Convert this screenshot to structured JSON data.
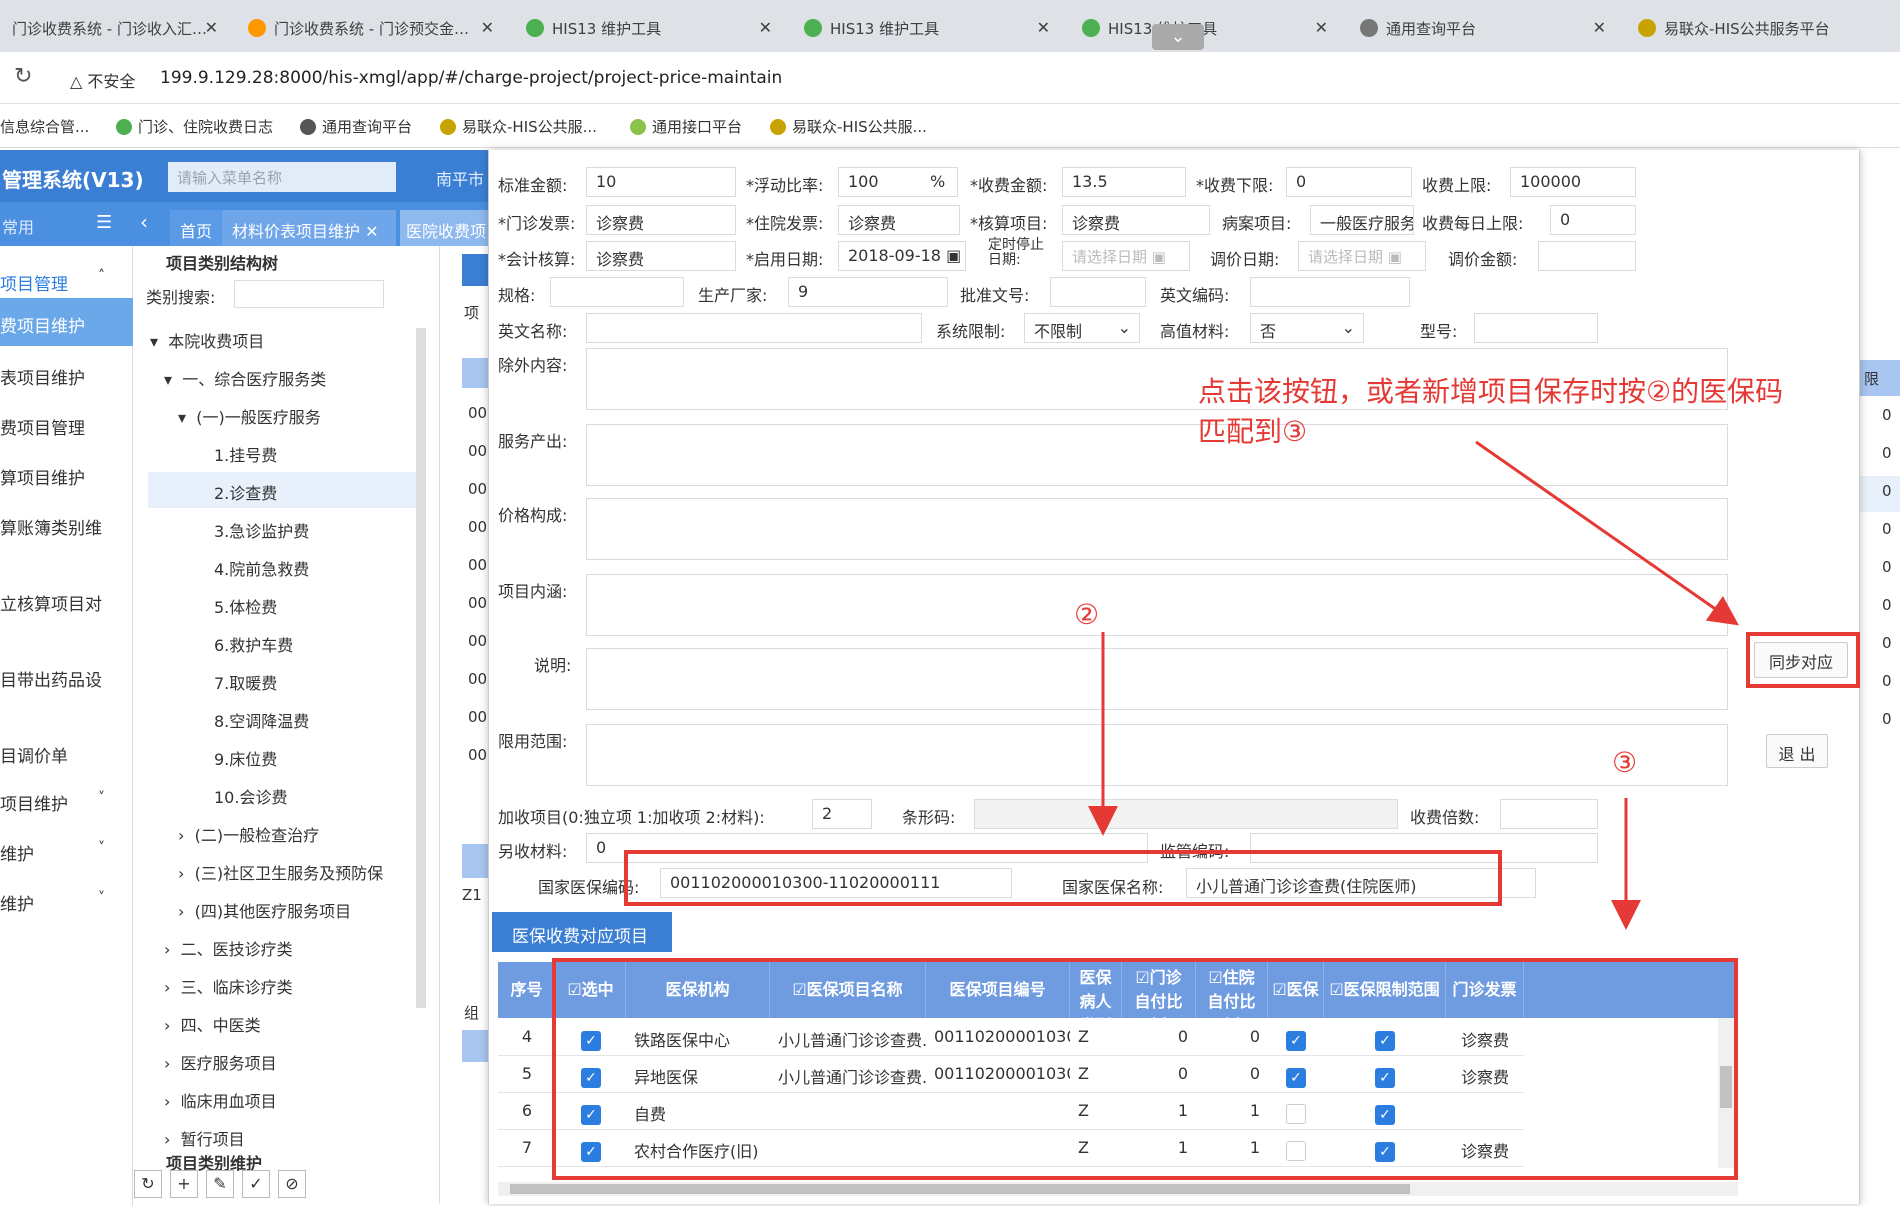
{
  "browser": {
    "tabs": [
      {
        "label": "门诊收费系统 - 门诊收入汇…",
        "color": "#4caf50"
      },
      {
        "label": "门诊收费系统 - 门诊预交金…",
        "color": "#ff9800"
      },
      {
        "label": "HIS13 维护工具",
        "color": "#4caf50"
      },
      {
        "label": "HIS13 维护工具",
        "color": "#4caf50"
      },
      {
        "label": "HIS13 维护工具",
        "color": "#4caf50"
      },
      {
        "label": "通用查询平台",
        "color": "#555"
      },
      {
        "label": "易联众-HIS公共服务平台",
        "color": "#c8a200"
      }
    ],
    "insecure": "不安全",
    "url": "199.9.129.28:8000/his-xmgl/app/#/charge-project/project-price-maintain",
    "bookmarks": [
      "信息综合管...",
      "门诊、住院收费日志",
      "通用查询平台",
      "易联众-HIS公共服...",
      "通用接口平台",
      "易联众-HIS公共服..."
    ]
  },
  "app": {
    "title": "管理系统(V13)",
    "menu_search_placeholder": "请输入菜单名称",
    "region": "南平市",
    "common": "常用",
    "nav_tabs": [
      "首页",
      "材料价表项目维护",
      "医院收费项"
    ]
  },
  "sidebar": [
    "项目管理",
    "费项目维护",
    "表项目维护",
    "费项目管理",
    "算项目维护",
    "算账簿类别维",
    "立核算项目对",
    "目带出药品设",
    "目调价单",
    "项目维护",
    "维护",
    "维护"
  ],
  "tree": {
    "title": "项目类别结构树",
    "search_label": "类别搜索:",
    "items": [
      "本院收费项目",
      "一、综合医疗服务类",
      "(一)一般医疗服务",
      "1.挂号费",
      "2.诊查费",
      "3.急诊监护费",
      "4.院前急救费",
      "5.体检费",
      "6.救护车费",
      "7.取暖费",
      "8.空调降温费",
      "9.床位费",
      "10.会诊费",
      "(二)一般检查治疗",
      "(三)社区卫生服务及预防保",
      "(四)其他医疗服务项目",
      "二、医技诊疗类",
      "三、临床诊疗类",
      "四、中医类",
      "医疗服务项目",
      "临床用血项目",
      "暂行项目"
    ],
    "footer": "项目类别维护"
  },
  "bg_codes": [
    "00",
    "00",
    "00",
    "00",
    "00",
    "00",
    "00",
    "00",
    "00",
    "00"
  ],
  "bg_misc": {
    "z": "Z1",
    "group": "组",
    "item": "项",
    "right_head": "限",
    "right_zeros": [
      "0",
      "0",
      "0",
      "0",
      "0",
      "0",
      "0",
      "0",
      "0"
    ]
  },
  "form": {
    "std_amount_label": "标准金额:",
    "std_amount": "10",
    "float_rate_label": "*浮动比率:",
    "float_rate": "100",
    "pct": "%",
    "fee_amount_label": "*收费金额:",
    "fee_amount": "13.5",
    "fee_lower_label": "*收费下限:",
    "fee_lower": "0",
    "fee_upper_label": "收费上限:",
    "fee_upper": "100000",
    "op_invoice_label": "*门诊发票:",
    "op_invoice": "诊察费",
    "ip_invoice_label": "*住院发票:",
    "ip_invoice": "诊察费",
    "acct_item_label": "*核算项目:",
    "acct_item": "诊察费",
    "case_item_label": "病案项目:",
    "case_item": "一般医疗服务",
    "daily_upper_label": "收费每日上限:",
    "daily_upper": "0",
    "accounting_label": "*会计核算:",
    "accounting": "诊察费",
    "start_date_label": "*启用日期:",
    "start_date": "2018-09-18",
    "stop_date_label": "定时停止日期:",
    "stop_date_ph": "请选择日期",
    "adj_date_label": "调价日期:",
    "adj_date_ph": "请选择日期",
    "adj_amount_label": "调价金额:",
    "spec_label": "规格:",
    "maker_label": "生产厂家:",
    "maker": "9",
    "approval_label": "批准文号:",
    "en_code_label": "英文编码:",
    "en_name_label": "英文名称:",
    "sys_limit_label": "系统限制:",
    "sys_limit": "不限制",
    "high_value_label": "高值材料:",
    "high_value": "否",
    "model_label": "型号:",
    "excl_label": "除外内容:",
    "service_label": "服务产出:",
    "price_label": "价格构成:",
    "connote_label": "项目内涵:",
    "desc_label": "说明:",
    "scope_label": "限用范围:",
    "addon_label": "加收项目(0:独立项 1:加收项 2:材料):",
    "addon": "2",
    "barcode_label": "条形码:",
    "multiple_label": "收费倍数:",
    "extra_mat_label": "另收材料:",
    "extra_mat": "0",
    "supervise_label": "监管编码:",
    "nat_code_label": "国家医保编码:",
    "nat_code": "001102000010300-11020000111",
    "nat_name_label": "国家医保名称:",
    "nat_name": "小儿普通门诊诊查费(住院医师)"
  },
  "buttons": {
    "sync": "同步对应",
    "exit": "退 出"
  },
  "section_title": "医保收费对应项目",
  "annotations": {
    "main": "点击该按钮，或者新增项目保存时按②的医保码",
    "main2": "匹配到③",
    "n2": "②",
    "n3": "③"
  },
  "table": {
    "headers": [
      "序号",
      "☑选中",
      "医保机构",
      "☑医保项目名称",
      "医保项目编号",
      "医保病人类别",
      "☑门诊自付比例",
      "☑住院自付比例",
      "☑医保",
      "☑医保限制范围",
      "门诊发票"
    ],
    "rows": [
      {
        "no": "4",
        "sel": true,
        "org": "铁路医保中心",
        "name": "小儿普通门诊诊查费...",
        "code": "001102000010300...",
        "cat": "Z",
        "op": "0",
        "ip": "0",
        "yb": true,
        "lim": true,
        "inv": "诊察费"
      },
      {
        "no": "5",
        "sel": true,
        "org": "异地医保",
        "name": "小儿普通门诊诊查费...",
        "code": "001102000010300...",
        "cat": "Z",
        "op": "0",
        "ip": "0",
        "yb": true,
        "lim": true,
        "inv": "诊察费"
      },
      {
        "no": "6",
        "sel": true,
        "org": "自费",
        "name": "",
        "code": "",
        "cat": "Z",
        "op": "1",
        "ip": "1",
        "yb": false,
        "lim": true,
        "inv": ""
      },
      {
        "no": "7",
        "sel": true,
        "org": "农村合作医疗(旧)",
        "name": "",
        "code": "",
        "cat": "Z",
        "op": "1",
        "ip": "1",
        "yb": false,
        "lim": true,
        "inv": "诊察费"
      }
    ]
  }
}
